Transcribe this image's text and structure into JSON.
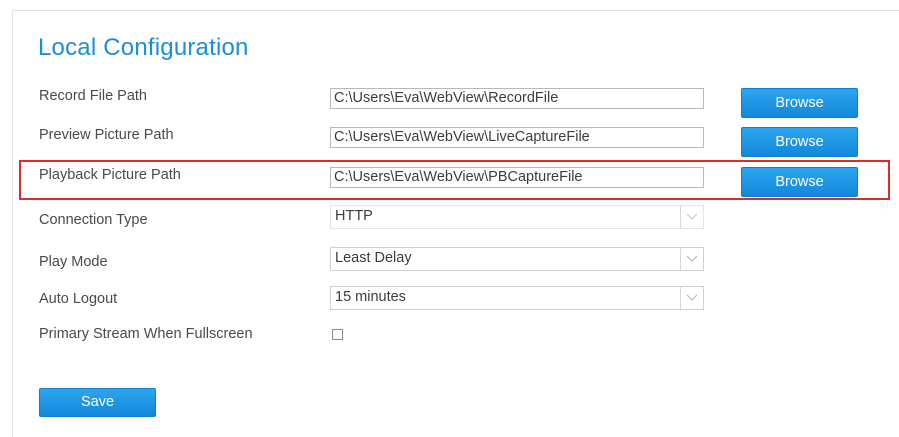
{
  "page": {
    "title": "Local Configuration"
  },
  "paths": [
    {
      "label": "Record File Path",
      "value": "C:\\Users\\Eva\\WebView\\RecordFile",
      "button": "Browse"
    },
    {
      "label": "Preview Picture Path",
      "value": "C:\\Users\\Eva\\WebView\\LiveCaptureFile",
      "button": "Browse"
    },
    {
      "label": "Playback Picture Path",
      "value": "C:\\Users\\Eva\\WebView\\PBCaptureFile",
      "button": "Browse"
    }
  ],
  "settings": {
    "connection_type": {
      "label": "Connection Type",
      "value": "HTTP"
    },
    "play_mode": {
      "label": "Play Mode",
      "value": "Least Delay"
    },
    "auto_logout": {
      "label": "Auto Logout",
      "value": "15 minutes"
    },
    "primary_stream": {
      "label": "Primary Stream When Fullscreen",
      "checked": false
    }
  },
  "actions": {
    "save_label": "Save"
  },
  "colors": {
    "accent": "#1a8fd8",
    "button": "#1a91e0",
    "highlight_border": "#e02a2a"
  },
  "icons": {
    "dropdown": "chevron-down-icon"
  }
}
